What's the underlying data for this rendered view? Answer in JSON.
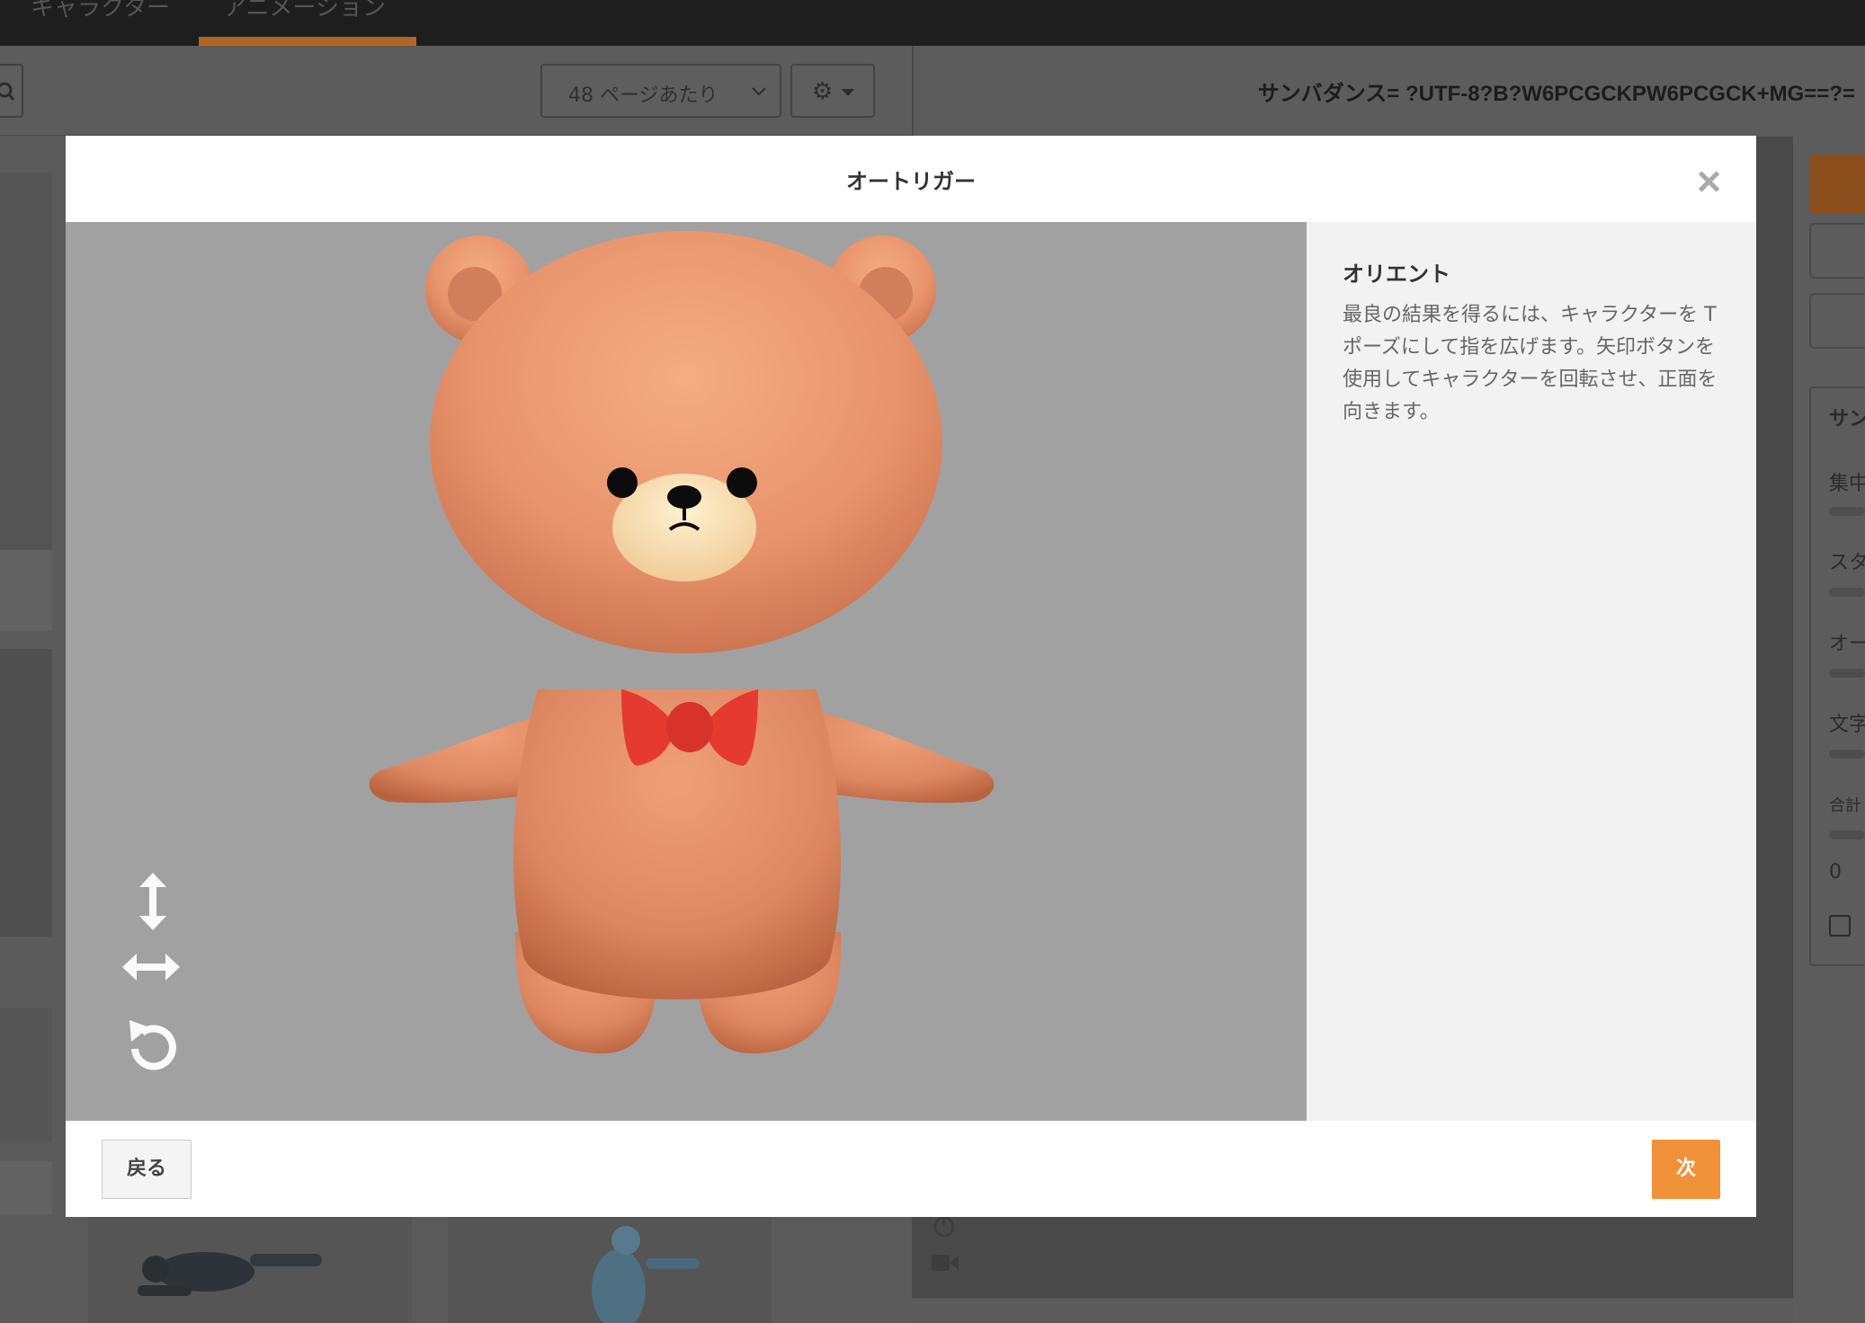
{
  "topbar": {
    "tabs": [
      {
        "label": "キャラクター"
      },
      {
        "label": "アニメーション"
      }
    ]
  },
  "toolbar": {
    "per_page_label": "48 ページあたり"
  },
  "right_header": {
    "title": "サンバダンス= ?UTF-8?B?W6PCGCKPW6PCGCK+MG==?="
  },
  "side_panel": {
    "title": "サン",
    "labels": [
      "集中",
      "スタ",
      "オー",
      "文字"
    ],
    "total_label": "合計",
    "total_value": "0"
  },
  "modal": {
    "title": "オートリガー",
    "info_title": "オリエント",
    "info_body": "最良の結果を得るには、キャラクターを T ポーズにして指を広げます。矢印ボタンを使用してキャラクターを回転させ、正面を向きます。",
    "back_label": "戻る",
    "next_label": "次",
    "controls": [
      "vertical-flip-icon",
      "horizontal-flip-icon",
      "rotate-icon"
    ]
  },
  "colors": {
    "accent": "#f0913a",
    "bear_fur": "#e8936c",
    "bow": "#e53a2f",
    "viewport_bg": "#a1a1a1"
  }
}
